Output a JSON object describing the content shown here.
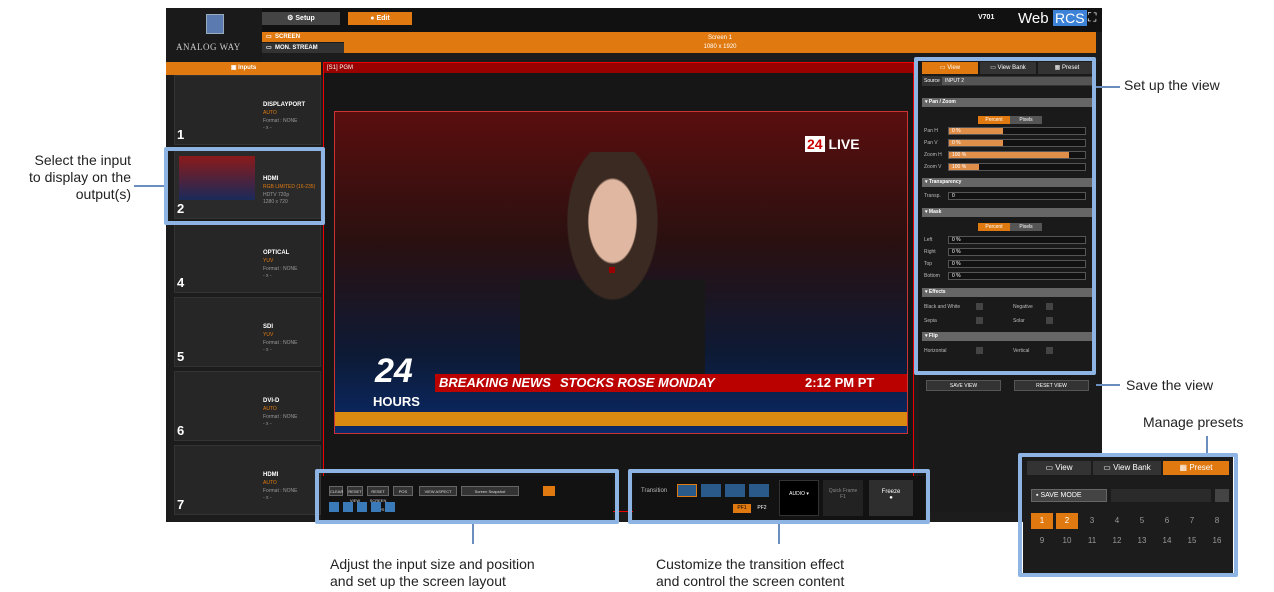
{
  "header": {
    "setup_label": "Setup",
    "edit_label": "Edit",
    "brand": "ANALOG WAY",
    "version": "V701",
    "product_web": "Web",
    "product_rcs": "RCS"
  },
  "screens": {
    "screen_label": "SCREEN",
    "mon_label": "MON. STREAM",
    "screen_name": "Screen 1",
    "screen_res": "1080 x 1920"
  },
  "inputs": {
    "header": "Inputs",
    "items": [
      {
        "num": "1",
        "name": "DISPLAYPORT",
        "fmt": "AUTO",
        "det": "Format : NONE",
        "det2": "- x -"
      },
      {
        "num": "2",
        "name": "HDMI",
        "fmt": "RGB LIMITED (16-235)",
        "det": "HDTV 720p",
        "det2": "1280 x 720"
      },
      {
        "num": "4",
        "name": "OPTICAL",
        "fmt": "YUV",
        "det": "Format : NONE",
        "det2": "- x -"
      },
      {
        "num": "5",
        "name": "SDI",
        "fmt": "YUV",
        "det": "Format : NONE",
        "det2": "- x -"
      },
      {
        "num": "6",
        "name": "DVI-D",
        "fmt": "AUTO",
        "det": "Format : NONE",
        "det2": "- x -"
      },
      {
        "num": "7",
        "name": "HDMI",
        "fmt": "AUTO",
        "det": "Format : NONE",
        "det2": "- x -"
      }
    ]
  },
  "pgm": {
    "label": "[S1] PGM"
  },
  "news": {
    "live": "LIVE",
    "logo_num": "24",
    "breaking": "BREAKING NEWS",
    "headline": "STOCKS ROSE MONDAY",
    "time": "2:12 PM PT",
    "hours": "HOURS"
  },
  "view_panel": {
    "tab_view": "View",
    "tab_bank": "View Bank",
    "tab_preset": "Preset",
    "source_label": "Source",
    "source_value": "INPUT 2",
    "pan_zoom": "Pan / Zoom",
    "percent": "Percent",
    "pixels": "Pixels",
    "pan_h": "Pan H",
    "pan_h_val": "0 %",
    "pan_v": "Pan V",
    "pan_v_val": "0 %",
    "zoom_h": "Zoom H",
    "zoom_h_val": "100 %",
    "zoom_v": "Zoom V",
    "zoom_v_val": "100 %",
    "transparency": "Transparency",
    "transp": "Transp.",
    "transp_val": "0",
    "mask": "Mask",
    "left": "Left",
    "right": "Right",
    "top": "Top",
    "bottom": "Bottom",
    "mask_val": "0 %",
    "effects": "Effects",
    "bw": "Black and White",
    "negative": "Negative",
    "sepia": "Sepia",
    "solar": "Solar",
    "flip": "Flip",
    "horizontal": "Horizontal",
    "vertical": "Vertical",
    "save_view": "SAVE VIEW",
    "reset_view": "RESET VIEW"
  },
  "toolbar": {
    "clear": "CLEAR",
    "reset_view": "RESET VIEW",
    "reset_screen": "RESET SCREEN VIEWS",
    "pos": "POS",
    "view_aspect": "VIEW ASPECT",
    "snapshot": "Screen Snapshot"
  },
  "transition": {
    "label": "Transition",
    "audio": "AUDIO",
    "quick_frame": "Quick Frame",
    "freeze": "Freeze",
    "pf1": "PF1",
    "pf2": "PF2",
    "f1": "F1"
  },
  "preset_panel": {
    "tab_view": "View",
    "tab_bank": "View Bank",
    "tab_preset": "Preset",
    "save_mode": "SAVE MODE",
    "numbers": [
      "1",
      "2",
      "3",
      "4",
      "5",
      "6",
      "7",
      "8",
      "9",
      "10",
      "11",
      "12",
      "13",
      "14",
      "15",
      "16"
    ]
  },
  "annotations": {
    "select_input": "Select the input\nto display on the\noutput(s)",
    "setup_view": "Set up the view",
    "save_view": "Save the view",
    "manage_presets": "Manage presets",
    "adjust": "Adjust the input size and position\nand set up the screen layout",
    "customize": "Customize the transition effect\nand control the screen content"
  }
}
